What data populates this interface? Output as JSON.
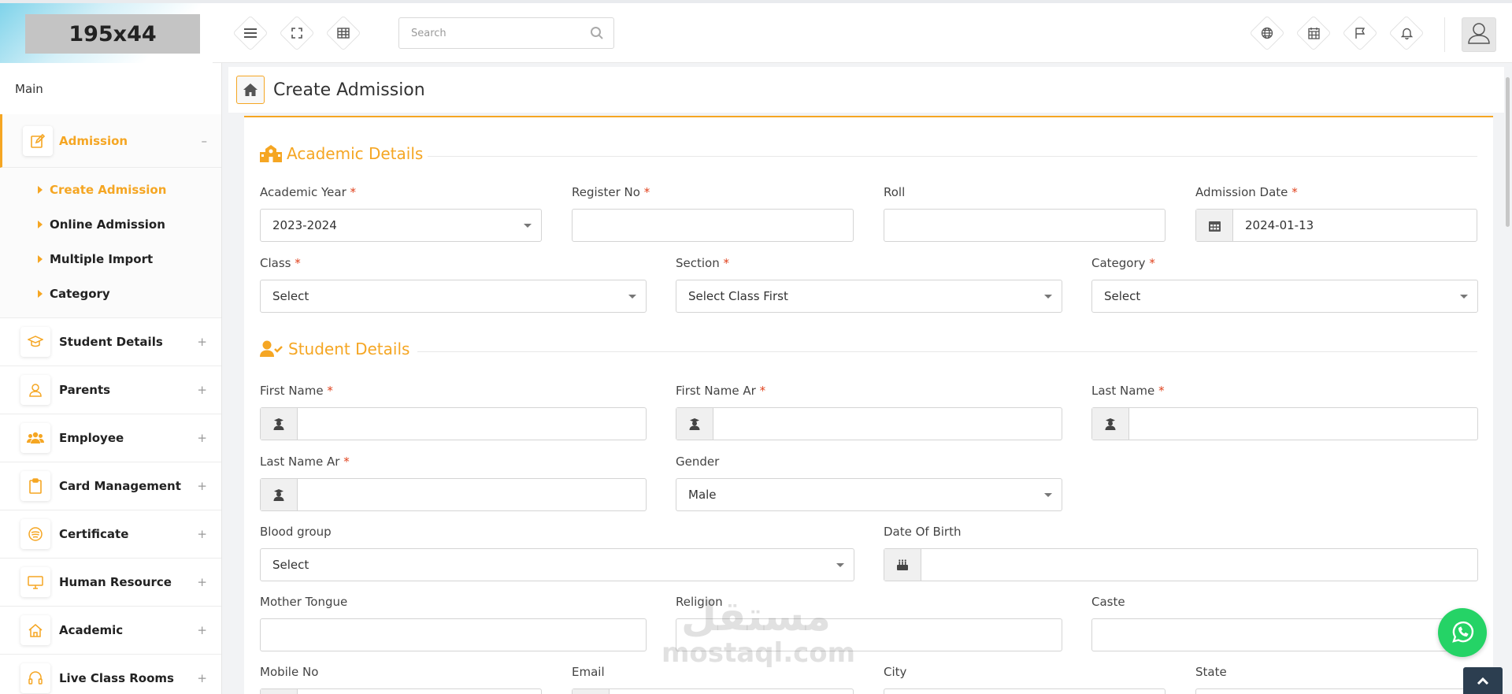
{
  "logo": {
    "text": "195x44"
  },
  "search": {
    "placeholder": "Search"
  },
  "topbar_icons": [
    "menu-icon",
    "fullscreen-icon",
    "grid-icon",
    "globe-icon",
    "calendar-icon",
    "flag-icon",
    "bell-icon"
  ],
  "avatar": {
    "label": "Photo"
  },
  "sidebar": {
    "section_label": "Main",
    "active": {
      "label": "Admission",
      "toggle": "–",
      "icon": "edit-icon"
    },
    "submenu": [
      {
        "label": "Create Admission"
      },
      {
        "label": "Online Admission"
      },
      {
        "label": "Multiple Import"
      },
      {
        "label": "Category"
      }
    ],
    "items": [
      {
        "label": "Student Details",
        "icon": "graduation-icon",
        "toggle": "+"
      },
      {
        "label": "Parents",
        "icon": "user-icon",
        "toggle": "+"
      },
      {
        "label": "Employee",
        "icon": "users-icon",
        "toggle": "+"
      },
      {
        "label": "Card Management",
        "icon": "clipboard-icon",
        "toggle": "+"
      },
      {
        "label": "Certificate",
        "icon": "certificate-icon",
        "toggle": "+"
      },
      {
        "label": "Human Resource",
        "icon": "monitor-icon",
        "toggle": "+"
      },
      {
        "label": "Academic",
        "icon": "home-icon",
        "toggle": "+"
      },
      {
        "label": "Live Class Rooms",
        "icon": "headset-icon",
        "toggle": "+"
      }
    ]
  },
  "header": {
    "title": "Create Admission"
  },
  "academic": {
    "title": "Academic Details",
    "academic_year": {
      "label": "Academic Year",
      "value": "2023-2024"
    },
    "register_no": {
      "label": "Register No",
      "value": ""
    },
    "roll": {
      "label": "Roll",
      "value": ""
    },
    "admission_date": {
      "label": "Admission Date",
      "value": "2024-01-13"
    },
    "class": {
      "label": "Class",
      "value": "Select"
    },
    "section": {
      "label": "Section",
      "value": "Select Class First"
    },
    "category": {
      "label": "Category",
      "value": "Select"
    }
  },
  "student": {
    "title": "Student Details",
    "first_name": {
      "label": "First Name",
      "value": ""
    },
    "first_name_ar": {
      "label": "First Name Ar",
      "value": ""
    },
    "last_name": {
      "label": "Last Name",
      "value": ""
    },
    "last_name_ar": {
      "label": "Last Name Ar",
      "value": ""
    },
    "gender": {
      "label": "Gender",
      "value": "Male"
    },
    "blood_group": {
      "label": "Blood group",
      "value": "Select"
    },
    "dob": {
      "label": "Date Of Birth",
      "value": ""
    },
    "mother_tongue": {
      "label": "Mother Tongue",
      "value": ""
    },
    "religion": {
      "label": "Religion",
      "value": ""
    },
    "caste": {
      "label": "Caste",
      "value": ""
    },
    "mobile": {
      "label": "Mobile No"
    },
    "email": {
      "label": "Email"
    },
    "city": {
      "label": "City"
    },
    "state": {
      "label": "State"
    }
  },
  "required_mark": "*",
  "watermark": {
    "arabic": "مستقل",
    "latin": "mostaql.com"
  },
  "colors": {
    "accent": "#f5a623",
    "required": "#e0421d",
    "whatsapp": "#25d366"
  }
}
